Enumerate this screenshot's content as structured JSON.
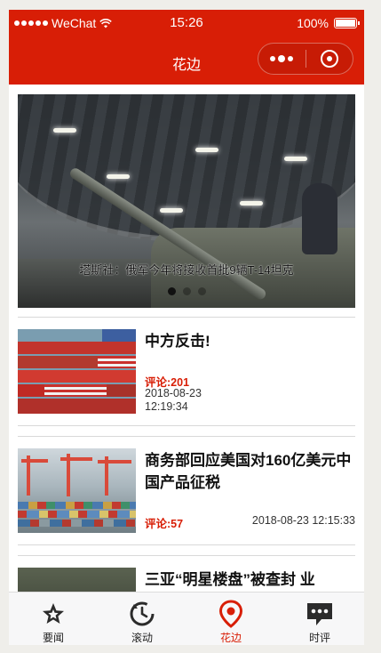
{
  "status_bar": {
    "carrier": "WeChat",
    "time": "15:26",
    "battery": "100%"
  },
  "nav": {
    "title": "花边"
  },
  "banner": {
    "caption": "塔斯社：俄军今年将接收首批9辆T-14坦克",
    "active_dot": 0,
    "dot_count": 3
  },
  "articles": [
    {
      "title": "中方反击!",
      "comment": "评论:201",
      "date": "2018-08-23 12:19:34"
    },
    {
      "title": "商务部回应美国对160亿美元中国产品征税",
      "comment": "评论:57",
      "date": "2018-08-23 12:15:33"
    },
    {
      "title": "三亚“明星楼盘”被查封 业"
    }
  ],
  "tabs": [
    {
      "label": "要闻",
      "icon": "star-icon"
    },
    {
      "label": "滚动",
      "icon": "refresh-icon"
    },
    {
      "label": "花边",
      "icon": "location-pin-icon"
    },
    {
      "label": "时评",
      "icon": "chat-bubble-icon"
    }
  ],
  "active_tab": 2,
  "colors": {
    "brand": "#d81e06"
  }
}
